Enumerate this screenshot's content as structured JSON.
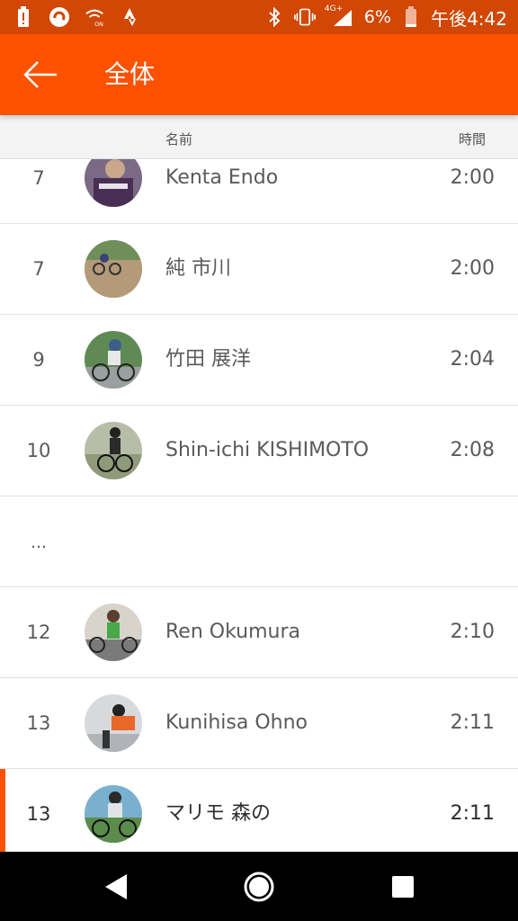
{
  "status_bar": {
    "battery": "6%",
    "time": "午後4:42",
    "network": "4G+",
    "icons": [
      "battery-alert-icon",
      "app-notification-icon",
      "wifi-calling-icon",
      "strava-icon",
      "bluetooth-icon",
      "vibrate-icon",
      "signal-icon",
      "battery-icon"
    ]
  },
  "app_bar": {
    "title": "全体",
    "back_icon": "arrow-back-icon"
  },
  "table_header": {
    "name": "名前",
    "time": "時間"
  },
  "rows": [
    {
      "rank": "7",
      "name": "Kenta Endo",
      "time": "2:00"
    },
    {
      "rank": "7",
      "name": "純 市川",
      "time": "2:00"
    },
    {
      "rank": "9",
      "name": "竹田 展洋",
      "time": "2:04"
    },
    {
      "rank": "10",
      "name": "Shin-ichi KISHIMOTO",
      "time": "2:08"
    },
    {
      "rank": "…",
      "name": "",
      "time": ""
    },
    {
      "rank": "12",
      "name": "Ren Okumura",
      "time": "2:10"
    },
    {
      "rank": "13",
      "name": "Kunihisa Ohno",
      "time": "2:11"
    },
    {
      "rank": "13",
      "name": "マリモ 森の",
      "time": "2:11"
    }
  ],
  "colors": {
    "accent": "#fc5200",
    "status_bar": "#d14703"
  },
  "nav": {
    "back": "nav-back-icon",
    "home": "nav-home-icon",
    "recents": "nav-recents-icon"
  }
}
